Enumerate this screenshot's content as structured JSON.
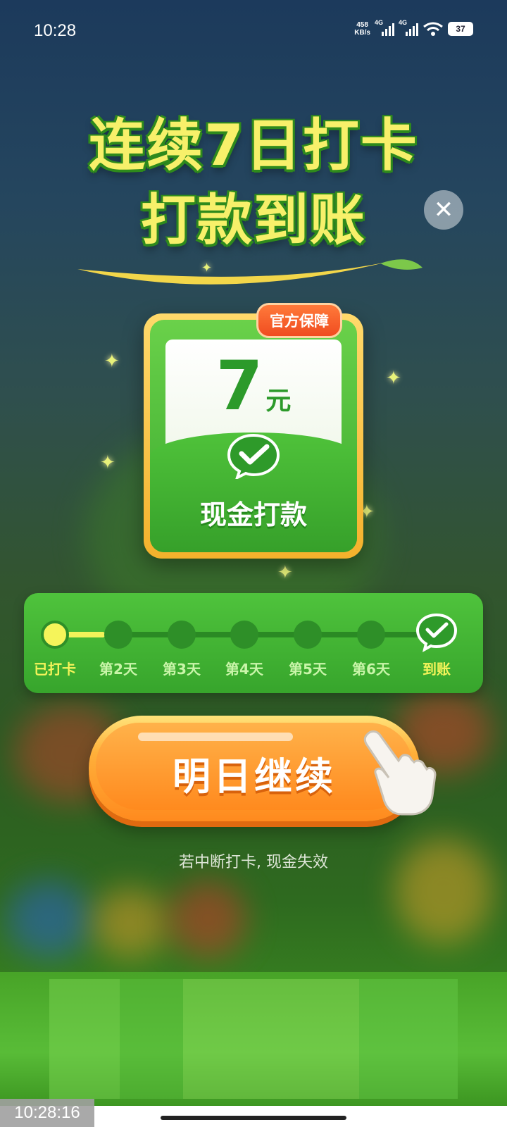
{
  "status_bar": {
    "time": "10:28",
    "net_speed_value": "458",
    "net_speed_unit": "KB/s",
    "sim1_label": "4G",
    "sim2_label": "4G",
    "battery": "37"
  },
  "headline": {
    "line1": "连续7日打卡",
    "line2": "打款到账"
  },
  "close_icon": "close-icon",
  "reward_card": {
    "badge": "官方保障",
    "amount": "7",
    "unit": "元",
    "label": "现金打款",
    "icon": "wechat-pay-icon"
  },
  "progress": {
    "checked_days": 1,
    "steps": [
      {
        "label": "已打卡",
        "state": "done"
      },
      {
        "label": "第2天",
        "state": "pending"
      },
      {
        "label": "第3天",
        "state": "pending"
      },
      {
        "label": "第4天",
        "state": "pending"
      },
      {
        "label": "第5天",
        "state": "pending"
      },
      {
        "label": "第6天",
        "state": "pending"
      },
      {
        "label": "到账",
        "state": "reward"
      }
    ]
  },
  "cta": {
    "label": "明日继续"
  },
  "hint": "若中断打卡, 现金失效",
  "screenshot_timestamp": "10:28:16",
  "colors": {
    "headline": "#f7f06a",
    "primary_green": "#3aa92e",
    "cta_orange": "#ff8a1e",
    "badge_red": "#f04c20"
  }
}
